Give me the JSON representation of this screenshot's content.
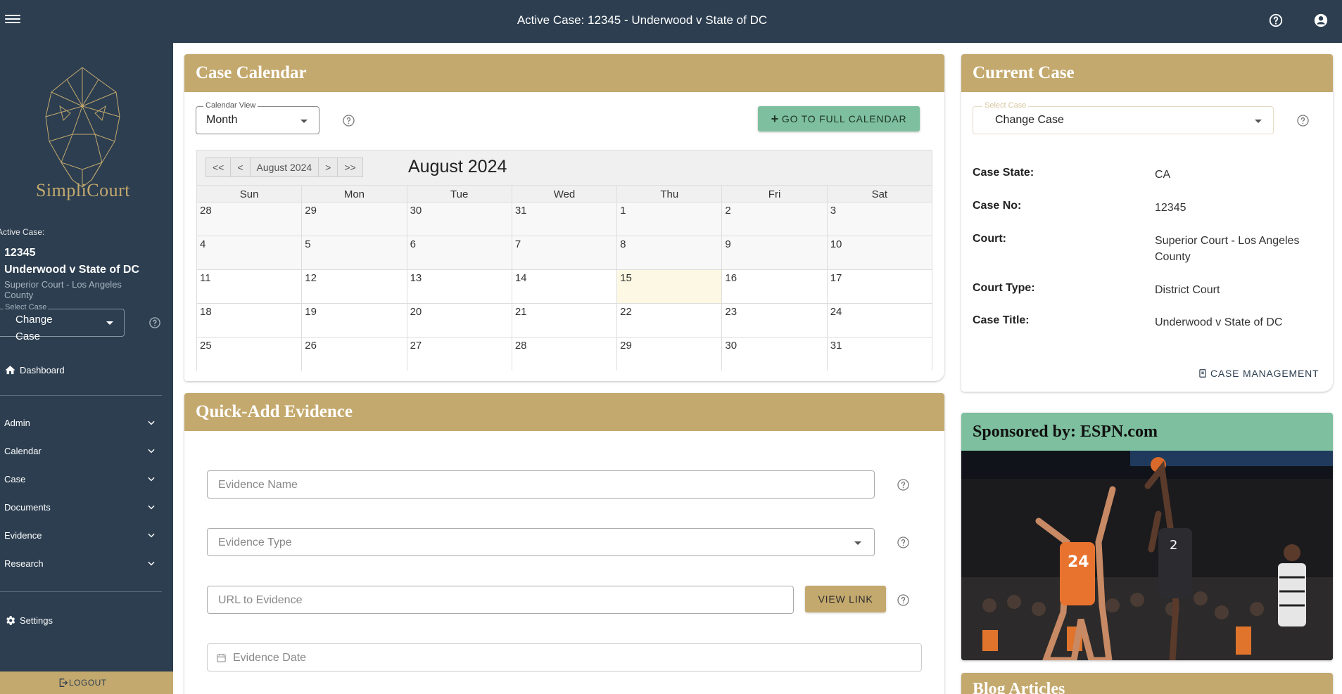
{
  "topbar": {
    "title": "Active Case: 12345 - Underwood v State of DC"
  },
  "sidebar": {
    "logo_text": "SimpliCourt",
    "active_case_label": "Active Case:",
    "case_no": "12345",
    "case_title": "Underwood v State of DC",
    "court": "Superior Court - Los Angeles County",
    "select_label": "Select Case",
    "select_value": "Change Case",
    "dashboard": "Dashboard",
    "items": [
      "Admin",
      "Calendar",
      "Case",
      "Documents",
      "Evidence",
      "Research"
    ],
    "settings": "Settings",
    "logout": "LOGOUT"
  },
  "calendar_card": {
    "title": "Case Calendar",
    "view_label": "Calendar View",
    "view_value": "Month",
    "full_calendar_btn": "GO TO FULL CALENDAR",
    "nav_first": "<<",
    "nav_prev": "<",
    "nav_current": "August 2024",
    "nav_next": ">",
    "nav_last": ">>",
    "month_title": "August 2024",
    "weekdays": [
      "Sun",
      "Mon",
      "Tue",
      "Wed",
      "Thu",
      "Fri",
      "Sat"
    ],
    "weeks": [
      [
        "28",
        "29",
        "30",
        "31",
        "1",
        "2",
        "3"
      ],
      [
        "4",
        "5",
        "6",
        "7",
        "8",
        "9",
        "10"
      ],
      [
        "11",
        "12",
        "13",
        "14",
        "15",
        "16",
        "17"
      ],
      [
        "18",
        "19",
        "20",
        "21",
        "22",
        "23",
        "24"
      ],
      [
        "25",
        "26",
        "27",
        "28",
        "29",
        "30",
        "31"
      ]
    ],
    "today": "15"
  },
  "quick_add": {
    "title": "Quick-Add Evidence",
    "name_placeholder": "Evidence Name",
    "type_placeholder": "Evidence Type",
    "url_placeholder": "URL to Evidence",
    "view_link_btn": "VIEW LINK",
    "date_placeholder": "Evidence Date"
  },
  "current_case": {
    "title": "Current Case",
    "select_label": "Select Case",
    "select_value": "Change Case",
    "fields": [
      {
        "label": "Case State:",
        "value": "CA"
      },
      {
        "label": "Case No:",
        "value": "12345"
      },
      {
        "label": "Court:",
        "value": "Superior Court - Los Angeles County"
      },
      {
        "label": "Court Type:",
        "value": "District Court"
      },
      {
        "label": "Case Title:",
        "value": "Underwood v State of DC"
      }
    ],
    "case_mgmt_btn": "CASE MANAGEMENT"
  },
  "sponsor": {
    "title": "Sponsored by: ESPN.com"
  },
  "blog": {
    "title": "Blog Articles"
  },
  "colors": {
    "navy": "#2c3e50",
    "gold": "#c4a96e",
    "mint": "#7dbf9e",
    "today": "#fcf8e3"
  }
}
